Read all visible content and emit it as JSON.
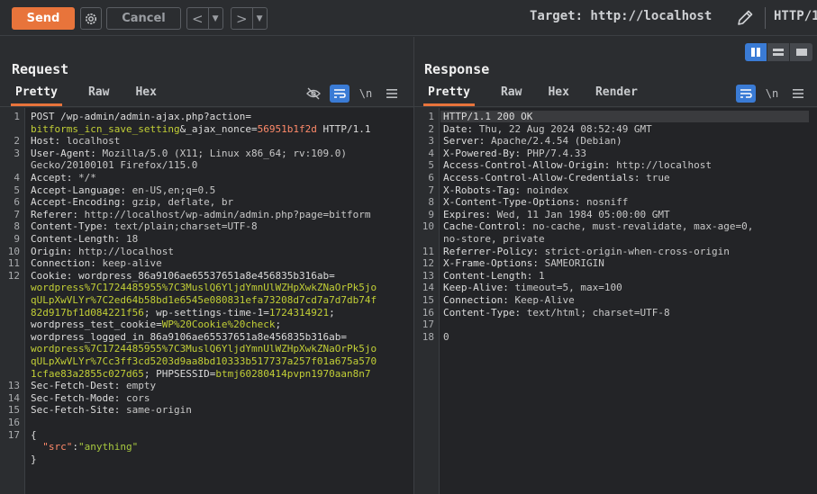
{
  "toolbar": {
    "send_label": "Send",
    "cancel_label": "Cancel",
    "back_icon": "chevron-left-icon",
    "forward_icon": "chevron-right-icon",
    "target_label": "Target: http://localhost",
    "protocol_label": "HTTP/1",
    "accent_color": "#e8743b"
  },
  "request": {
    "title": "Request",
    "tabs": [
      "Pretty",
      "Raw",
      "Hex"
    ],
    "active_tab": "Pretty",
    "line_numbers": [
      "1",
      "2",
      "3",
      "4",
      "5",
      "6",
      "7",
      "8",
      "9",
      "10",
      "11",
      "12",
      "13",
      "14",
      "15",
      "16",
      "17"
    ],
    "lines": [
      {
        "n": "1",
        "rows": [
          [
            {
              "c": "k",
              "t": "POST /wp-admin/admin-ajax.php?action="
            }
          ],
          [
            {
              "c": "p",
              "t": "bitforms_icn_save_setting"
            },
            {
              "c": "k",
              "t": "&_ajax_nonce="
            },
            {
              "c": "r",
              "t": "56951b1f2d"
            },
            {
              "c": "k",
              "t": " HTTP/1.1"
            }
          ]
        ]
      },
      {
        "n": "2",
        "rows": [
          [
            {
              "c": "k",
              "t": "Host: "
            },
            {
              "c": "v",
              "t": "localhost"
            }
          ]
        ]
      },
      {
        "n": "3",
        "rows": [
          [
            {
              "c": "k",
              "t": "User-Agent: "
            },
            {
              "c": "v",
              "t": "Mozilla/5.0 (X11; Linux x86_64; rv:109.0)"
            }
          ],
          [
            {
              "c": "v",
              "t": "Gecko/20100101 Firefox/115.0"
            }
          ]
        ]
      },
      {
        "n": "4",
        "rows": [
          [
            {
              "c": "k",
              "t": "Accept: "
            },
            {
              "c": "v",
              "t": "*/*"
            }
          ]
        ]
      },
      {
        "n": "5",
        "rows": [
          [
            {
              "c": "k",
              "t": "Accept-Language: "
            },
            {
              "c": "v",
              "t": "en-US,en;q=0.5"
            }
          ]
        ]
      },
      {
        "n": "6",
        "rows": [
          [
            {
              "c": "k",
              "t": "Accept-Encoding: "
            },
            {
              "c": "v",
              "t": "gzip, deflate, br"
            }
          ]
        ]
      },
      {
        "n": "7",
        "rows": [
          [
            {
              "c": "k",
              "t": "Referer: "
            },
            {
              "c": "v",
              "t": "http://localhost/wp-admin/admin.php?page=bitform"
            }
          ]
        ]
      },
      {
        "n": "8",
        "rows": [
          [
            {
              "c": "k",
              "t": "Content-Type: "
            },
            {
              "c": "v",
              "t": "text/plain;charset=UTF-8"
            }
          ]
        ]
      },
      {
        "n": "9",
        "rows": [
          [
            {
              "c": "k",
              "t": "Content-Length: "
            },
            {
              "c": "v",
              "t": "18"
            }
          ]
        ]
      },
      {
        "n": "10",
        "rows": [
          [
            {
              "c": "k",
              "t": "Origin: "
            },
            {
              "c": "v",
              "t": "http://localhost"
            }
          ]
        ]
      },
      {
        "n": "11",
        "rows": [
          [
            {
              "c": "k",
              "t": "Connection: "
            },
            {
              "c": "v",
              "t": "keep-alive"
            }
          ]
        ]
      },
      {
        "n": "12",
        "rows": [
          [
            {
              "c": "k",
              "t": "Cookie: "
            },
            {
              "c": "k",
              "t": "wordpress_86a9106ae65537651a8e456835b316ab="
            }
          ],
          [
            {
              "c": "p",
              "t": "wordpress%7C1724485955%7C3MuslQ6YljdYmnUlWZHpXwkZNaOrPk5jo"
            }
          ],
          [
            {
              "c": "p",
              "t": "qULpXwVLYr%7C2ed64b58bd1e6545e080831efa73208d7cd7a7d7db74f"
            }
          ],
          [
            {
              "c": "p",
              "t": "82d917bf1d084221f56"
            },
            {
              "c": "k",
              "t": "; wp-settings-time-1="
            },
            {
              "c": "p",
              "t": "1724314921"
            },
            {
              "c": "k",
              "t": ";"
            }
          ],
          [
            {
              "c": "k",
              "t": "wordpress_test_cookie="
            },
            {
              "c": "p",
              "t": "WP%20Cookie%20check"
            },
            {
              "c": "k",
              "t": ";"
            }
          ],
          [
            {
              "c": "k",
              "t": "wordpress_logged_in_86a9106ae65537651a8e456835b316ab="
            }
          ],
          [
            {
              "c": "p",
              "t": "wordpress%7C1724485955%7C3MuslQ6YljdYmnUlWZHpXwkZNaOrPk5jo"
            }
          ],
          [
            {
              "c": "p",
              "t": "qULpXwVLYr%7Cc3ff3cd5203d9aa8bd10333b517737a257f01a675a570"
            }
          ],
          [
            {
              "c": "p",
              "t": "1cfae83a2855c027d65"
            },
            {
              "c": "k",
              "t": "; PHPSESSID="
            },
            {
              "c": "p",
              "t": "btmj60280414pvpn1970aan8n7"
            }
          ]
        ]
      },
      {
        "n": "13",
        "rows": [
          [
            {
              "c": "k",
              "t": "Sec-Fetch-Dest: "
            },
            {
              "c": "v",
              "t": "empty"
            }
          ]
        ]
      },
      {
        "n": "14",
        "rows": [
          [
            {
              "c": "k",
              "t": "Sec-Fetch-Mode: "
            },
            {
              "c": "v",
              "t": "cors"
            }
          ]
        ]
      },
      {
        "n": "15",
        "rows": [
          [
            {
              "c": "k",
              "t": "Sec-Fetch-Site: "
            },
            {
              "c": "v",
              "t": "same-origin"
            }
          ]
        ]
      },
      {
        "n": "16",
        "rows": [
          [
            {
              "c": "k",
              "t": ""
            }
          ]
        ]
      },
      {
        "n": "17",
        "rows": [
          [
            {
              "c": "k",
              "t": "{"
            }
          ],
          [
            {
              "c": "k",
              "t": "  "
            },
            {
              "c": "r",
              "t": "\"src\""
            },
            {
              "c": "k",
              "t": ":"
            },
            {
              "c": "t",
              "t": "\"anything\""
            }
          ],
          [
            {
              "c": "k",
              "t": "}"
            }
          ]
        ]
      }
    ]
  },
  "response": {
    "title": "Response",
    "tabs": [
      "Pretty",
      "Raw",
      "Hex",
      "Render"
    ],
    "active_tab": "Pretty",
    "lines": [
      {
        "n": "1",
        "rows": [
          [
            {
              "c": "k",
              "t": "HTTP/1.1 200 OK"
            }
          ]
        ]
      },
      {
        "n": "2",
        "rows": [
          [
            {
              "c": "k",
              "t": "Date: "
            },
            {
              "c": "v",
              "t": "Thu, 22 Aug 2024 08:52:49 GMT"
            }
          ]
        ]
      },
      {
        "n": "3",
        "rows": [
          [
            {
              "c": "k",
              "t": "Server: "
            },
            {
              "c": "v",
              "t": "Apache/2.4.54 (Debian)"
            }
          ]
        ]
      },
      {
        "n": "4",
        "rows": [
          [
            {
              "c": "k",
              "t": "X-Powered-By: "
            },
            {
              "c": "v",
              "t": "PHP/7.4.33"
            }
          ]
        ]
      },
      {
        "n": "5",
        "rows": [
          [
            {
              "c": "k",
              "t": "Access-Control-Allow-Origin: "
            },
            {
              "c": "v",
              "t": "http://localhost"
            }
          ]
        ]
      },
      {
        "n": "6",
        "rows": [
          [
            {
              "c": "k",
              "t": "Access-Control-Allow-Credentials: "
            },
            {
              "c": "v",
              "t": "true"
            }
          ]
        ]
      },
      {
        "n": "7",
        "rows": [
          [
            {
              "c": "k",
              "t": "X-Robots-Tag: "
            },
            {
              "c": "v",
              "t": "noindex"
            }
          ]
        ]
      },
      {
        "n": "8",
        "rows": [
          [
            {
              "c": "k",
              "t": "X-Content-Type-Options: "
            },
            {
              "c": "v",
              "t": "nosniff"
            }
          ]
        ]
      },
      {
        "n": "9",
        "rows": [
          [
            {
              "c": "k",
              "t": "Expires: "
            },
            {
              "c": "v",
              "t": "Wed, 11 Jan 1984 05:00:00 GMT"
            }
          ]
        ]
      },
      {
        "n": "10",
        "rows": [
          [
            {
              "c": "k",
              "t": "Cache-Control: "
            },
            {
              "c": "v",
              "t": "no-cache, must-revalidate, max-age=0,"
            }
          ],
          [
            {
              "c": "v",
              "t": "no-store, private"
            }
          ]
        ]
      },
      {
        "n": "11",
        "rows": [
          [
            {
              "c": "k",
              "t": "Referrer-Policy: "
            },
            {
              "c": "v",
              "t": "strict-origin-when-cross-origin"
            }
          ]
        ]
      },
      {
        "n": "12",
        "rows": [
          [
            {
              "c": "k",
              "t": "X-Frame-Options: "
            },
            {
              "c": "v",
              "t": "SAMEORIGIN"
            }
          ]
        ]
      },
      {
        "n": "13",
        "rows": [
          [
            {
              "c": "k",
              "t": "Content-Length: "
            },
            {
              "c": "v",
              "t": "1"
            }
          ]
        ]
      },
      {
        "n": "14",
        "rows": [
          [
            {
              "c": "k",
              "t": "Keep-Alive: "
            },
            {
              "c": "v",
              "t": "timeout=5, max=100"
            }
          ]
        ]
      },
      {
        "n": "15",
        "rows": [
          [
            {
              "c": "k",
              "t": "Connection: "
            },
            {
              "c": "v",
              "t": "Keep-Alive"
            }
          ]
        ]
      },
      {
        "n": "16",
        "rows": [
          [
            {
              "c": "k",
              "t": "Content-Type: "
            },
            {
              "c": "v",
              "t": "text/html; charset=UTF-8"
            }
          ]
        ]
      },
      {
        "n": "17",
        "rows": [
          [
            {
              "c": "k",
              "t": ""
            }
          ]
        ]
      },
      {
        "n": "18",
        "rows": [
          [
            {
              "c": "v",
              "t": "0"
            }
          ]
        ]
      }
    ]
  },
  "editor_icons": {
    "hide_nonprint": "eye-slash-icon",
    "wrap": "wrap-lines-icon",
    "newline_label": "\\n",
    "menu": "hamburger-menu-icon"
  }
}
